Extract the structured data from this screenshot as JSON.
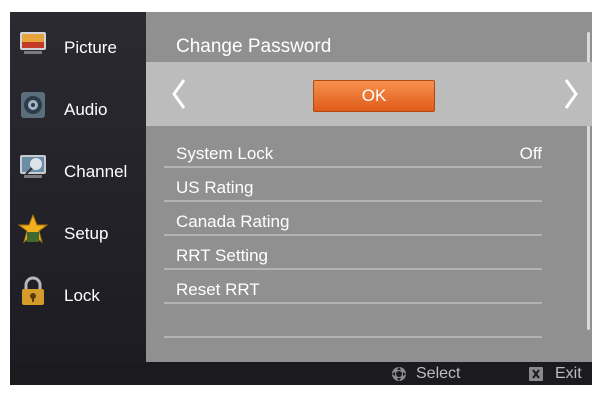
{
  "sidebar": {
    "items": [
      {
        "label": "Picture",
        "icon": "picture-icon"
      },
      {
        "label": "Audio",
        "icon": "speaker-icon"
      },
      {
        "label": "Channel",
        "icon": "satellite-icon"
      },
      {
        "label": "Setup",
        "icon": "star-icon"
      },
      {
        "label": "Lock",
        "icon": "padlock-icon"
      }
    ],
    "active": "Lock"
  },
  "main": {
    "title": "Change Password",
    "ok_label": "OK",
    "rows": [
      {
        "label": "System Lock",
        "value": "Off"
      },
      {
        "label": "US Rating",
        "value": ""
      },
      {
        "label": "Canada Rating",
        "value": ""
      },
      {
        "label": "RRT Setting",
        "value": ""
      },
      {
        "label": "Reset RRT",
        "value": ""
      },
      {
        "label": "",
        "value": ""
      }
    ]
  },
  "footer": {
    "select_label": "Select",
    "exit_label": "Exit"
  },
  "colors": {
    "ok_button": "#e8642a",
    "panel_background": "#909090",
    "sidebar_background": "#22222a"
  }
}
